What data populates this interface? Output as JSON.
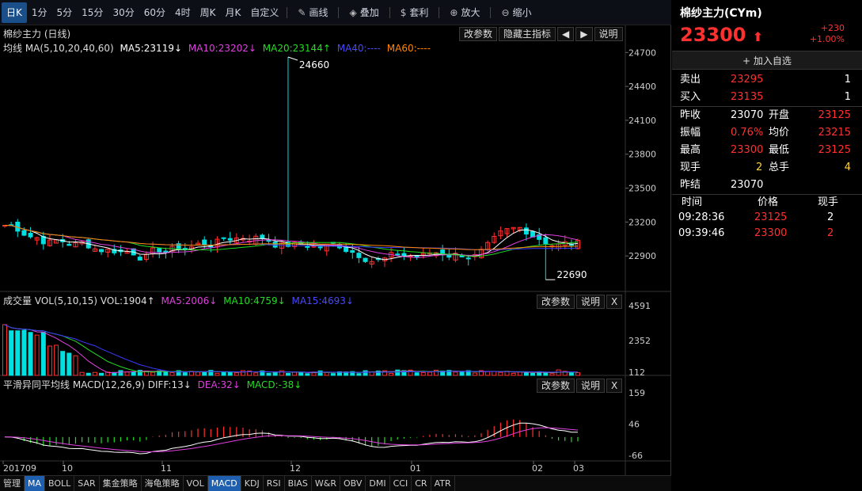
{
  "toolbar": {
    "periods": [
      "日K",
      "1分",
      "5分",
      "15分",
      "30分",
      "60分",
      "4时",
      "周K",
      "月K",
      "自定义"
    ],
    "tools": [
      {
        "icon": "pen-icon",
        "label": "画线"
      },
      {
        "icon": "layers-icon",
        "label": "叠加"
      },
      {
        "icon": "money-bag-icon",
        "label": "套利"
      },
      {
        "icon": "zoom-in-icon",
        "label": "放大"
      },
      {
        "icon": "zoom-out-icon",
        "label": "缩小"
      }
    ],
    "more_icon": "chevron-right-icon"
  },
  "main": {
    "title": "棉纱主力 (日线)",
    "ma_label": "均线 MA(5,10,20,40,60)",
    "ma5": "MA5:23119↓",
    "ma10": "MA10:23202↓",
    "ma20": "MA20:23144↑",
    "ma40": "MA40:----",
    "ma60": "MA60:----",
    "buttons": [
      "改参数",
      "隐藏主指标",
      "◀",
      "▶",
      "说明"
    ],
    "high_label": "24660",
    "low_label": "22690",
    "y_ticks": [
      "24700",
      "24400",
      "24100",
      "23800",
      "23500",
      "23200",
      "22900"
    ]
  },
  "volume": {
    "title": "成交量 VOL(5,10,15) VOL:1904↑",
    "ma5": "MA5:2006↓",
    "ma10": "MA10:4759↓",
    "ma15": "MA15:4693↓",
    "buttons": [
      "改参数",
      "说明",
      "X"
    ],
    "y_ticks": [
      "4591",
      "2352",
      "112"
    ]
  },
  "macd": {
    "title": "平滑异同平均线 MACD(12,26,9) DIFF:13↓",
    "dea": "DEA:32↓",
    "macd": "MACD:-38↓",
    "buttons": [
      "改参数",
      "说明",
      "X"
    ],
    "y_ticks": [
      "159",
      "46",
      "-66"
    ]
  },
  "x_axis": [
    "201709",
    "10",
    "11",
    "12",
    "01",
    "02",
    "03"
  ],
  "indicators": [
    "管理",
    "MA",
    "BOLL",
    "SAR",
    "集金策略",
    "海龟策略",
    "VOL",
    "MACD",
    "KDJ",
    "RSI",
    "BIAS",
    "W&R",
    "OBV",
    "DMI",
    "CCI",
    "CR",
    "ATR"
  ],
  "quote": {
    "name": "棉纱主力(CYm)",
    "price": "23300",
    "change": "+230",
    "change_pct": "+1.00%",
    "add_watch": "加入自选",
    "sell_label": "卖出",
    "sell_price": "23295",
    "sell_vol": "1",
    "buy_label": "买入",
    "buy_price": "23135",
    "buy_vol": "1",
    "prev_close_label": "昨收",
    "prev_close": "23070",
    "open_label": "开盘",
    "open": "23125",
    "amp_label": "振幅",
    "amp": "0.76%",
    "avg_label": "均价",
    "avg": "23215",
    "high_label": "最高",
    "high": "23300",
    "low_label": "最低",
    "low": "23125",
    "cur_hand_label": "现手",
    "cur_hand": "2",
    "total_hand_label": "总手",
    "total_hand": "4",
    "prev_settle_label": "昨结",
    "prev_settle": "23070",
    "ticks_header": [
      "时间",
      "价格",
      "现手"
    ],
    "ticks": [
      {
        "time": "09:28:36",
        "price": "23125",
        "vol": "2"
      },
      {
        "time": "09:39:46",
        "price": "23300",
        "vol": "2"
      }
    ]
  },
  "colors": {
    "up": "#ff3030",
    "down": "#00e0e0",
    "ma5": "#ffffff",
    "ma10": "#e040e0",
    "ma20": "#22dd22",
    "ma40": "#3a3aff",
    "ma60": "#ff8800",
    "yellow": "#ffd33a"
  }
}
